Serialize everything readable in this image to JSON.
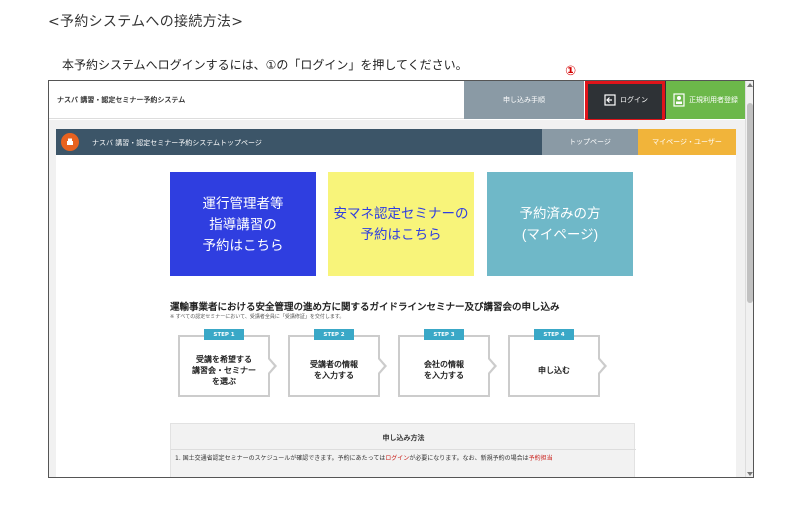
{
  "doc": {
    "heading": "<予約システムへの接続方法>",
    "instruction": "本予約システムへログインするには、①の「ログイン」を押してください。",
    "callout_number": "①"
  },
  "header": {
    "app_title": "ナスバ 講習・認定セミナー予約システム",
    "flow_label": "申し込み手順",
    "login_label": "ログイン",
    "register_label": "正規利用者登録",
    "icons": {
      "login": "login-arrow-icon",
      "register": "user-card-icon"
    }
  },
  "nav": {
    "title": "ナスバ 講習・認定セミナー予約システムトップページ",
    "top_link": "トップページ",
    "mypage_link": "マイページ・ユーザー",
    "logo_icon": "nasva-logo-icon"
  },
  "main": {
    "buttons": [
      {
        "label": "運行管理者等\n指導講習の\n予約はこちら"
      },
      {
        "label": "安マネ認定セミナーの\n予約はこちら"
      },
      {
        "label": "予約済みの方\n(マイページ)"
      }
    ],
    "section_title": "運輸事業者における安全管理の進め方に関するガイドラインセミナー及び講習会の申し込み",
    "section_note": "※ すべての認定セミナーにおいて、受講者全員に「受講修証」を交付します。",
    "steps": [
      {
        "tag": "STEP 1",
        "text": "受講を希望する\n講習会・セミナー\nを選ぶ"
      },
      {
        "tag": "STEP 2",
        "text": "受講者の情報\nを入力する"
      },
      {
        "tag": "STEP 3",
        "text": "会社の情報\nを入力する"
      },
      {
        "tag": "STEP 4",
        "text": "申し込む"
      }
    ],
    "method": {
      "title": "申し込み方法",
      "text_before": "1. 国土交通省認定セミナーのスケジュールが確認できます。予約にあたっては",
      "text_login": "ログイン",
      "text_middle": "が必要になります。なお、新規予約の場合は",
      "text_end": "予約担当"
    }
  },
  "colors": {
    "blue_button": "#2f3ee0",
    "yellow_button": "#f8f47a",
    "teal_button": "#6fb8c8",
    "nav_bar": "#3c5568",
    "login_button": "#2e3236",
    "register_button": "#6cb84a",
    "highlight": "#e0141a",
    "step_tag": "#3aa8c7"
  }
}
